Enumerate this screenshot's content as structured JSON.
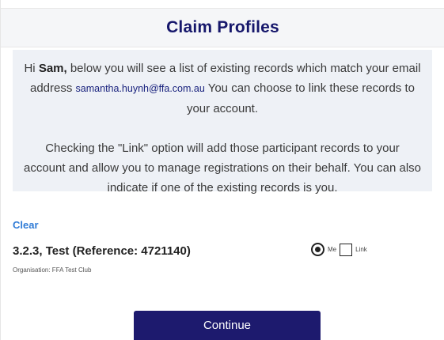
{
  "header": {
    "title": "Claim Profiles"
  },
  "intro": {
    "greeting": "Hi ",
    "name": "Sam,",
    "text_before_email": " below you will see a list of existing records which match your email address ",
    "email": "samantha.huynh@ffa.com.au",
    "text_after_email": " You can choose to link these records to your account.",
    "paragraph2": "Checking the \"Link\" option will add those participant records to your account and allow you to manage registrations on their behalf. You can also indicate if one of the existing records is you."
  },
  "actions": {
    "clear_label": "Clear",
    "continue_label": "Continue"
  },
  "record": {
    "title": "3.2.3, Test (Reference: 4721140)",
    "organisation": "Organisation: FFA Test Club",
    "me_label": "Me",
    "link_label": "Link",
    "me_selected": true,
    "link_checked": false
  }
}
